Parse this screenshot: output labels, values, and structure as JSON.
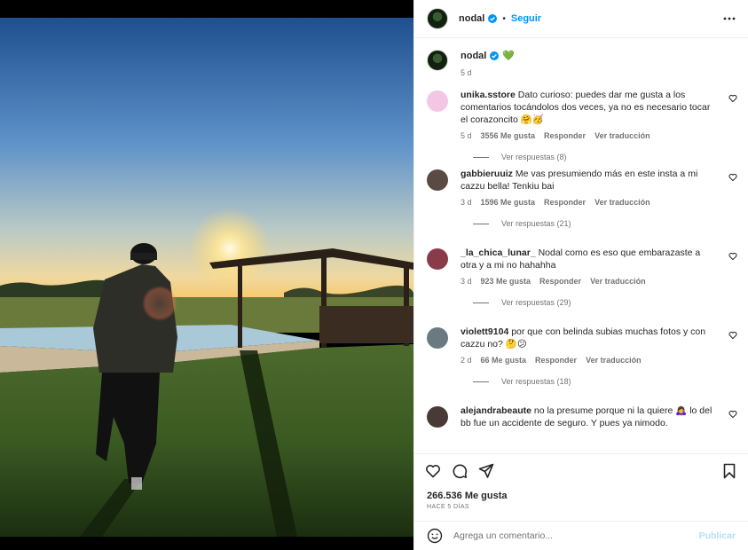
{
  "post": {
    "username": "nodal",
    "follow_label": "Seguir",
    "separator": "•",
    "caption_emoji": "💚",
    "caption_time": "5 d",
    "likes": "266.536 Me gusta",
    "posted_ago": "HACE 5 DÍAS"
  },
  "comments": [
    {
      "user": "unika.sstore",
      "text": "Dato curioso: puedes dar me gusta a los comentarios tocándolos dos veces, ya no es necesario tocar el corazoncito 🤗🥳",
      "time": "5 d",
      "likes": "3556 Me gusta",
      "reply": "Responder",
      "translate": "Ver traducción",
      "replies": "Ver respuestas (8)",
      "avatar_color": "#f3c6e6"
    },
    {
      "user": "gabbieruuiz",
      "text": "Me vas presumiendo más en este insta a mi cazzu bella! Tenkiu bai",
      "time": "3 d",
      "likes": "1596 Me gusta",
      "reply": "Responder",
      "translate": "Ver traducción",
      "replies": "Ver respuestas (21)",
      "avatar_color": "#5a4a44"
    },
    {
      "user": "_la_chica_lunar_",
      "text": "Nodal como es eso que embarazaste a otra y a mi no hahahha",
      "time": "3 d",
      "likes": "923 Me gusta",
      "reply": "Responder",
      "translate": "Ver traducción",
      "replies": "Ver respuestas (29)",
      "avatar_color": "#8a3b4a"
    },
    {
      "user": "violett9104",
      "text": "por que con belinda subias muchas fotos y con cazzu no? 🤔😕",
      "time": "2 d",
      "likes": "66 Me gusta",
      "reply": "Responder",
      "translate": "Ver traducción",
      "replies": "Ver respuestas (18)",
      "avatar_color": "#6b7a80"
    },
    {
      "user": "alejandrabeaute",
      "text": "no la presume porque ni la quiere 🙇‍♀️ lo del bb fue un accidente de seguro. Y pues ya nimodo.",
      "avatar_color": "#4a3a36"
    }
  ],
  "composer": {
    "placeholder": "Agrega un comentario...",
    "publish_label": "Publicar"
  },
  "colors": {
    "accent": "#0095f6",
    "verified": "#0095f6",
    "muted": "#737373"
  },
  "icons": [
    "more-icon",
    "heart-icon",
    "comment-icon",
    "share-icon",
    "save-icon",
    "emoji-icon",
    "verified-icon"
  ]
}
